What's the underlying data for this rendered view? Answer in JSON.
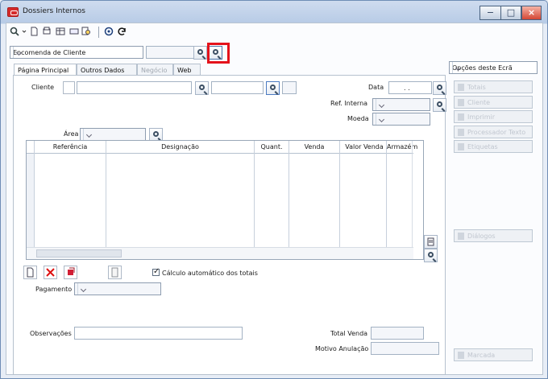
{
  "window": {
    "title": "Dossiers Internos"
  },
  "toolbar": {
    "icons": [
      "search-icon",
      "new-document-icon",
      "print-icon",
      "table-icon",
      "keyboard-icon",
      "document-search-icon",
      "settings-icon",
      "refresh-icon"
    ]
  },
  "document_type": {
    "value": "Encomenda de Cliente"
  },
  "tabs": [
    {
      "label": "Página Principal"
    },
    {
      "label": "Outros Dados"
    },
    {
      "label": "Negócio"
    },
    {
      "label": "Web"
    }
  ],
  "fields": {
    "cliente": "Cliente",
    "data": "Data",
    "data_value": ". .",
    "ref_interna": "Ref. Interna",
    "moeda": "Moeda",
    "area": "Área",
    "pagamento": "Pagamento",
    "observacoes": "Observações",
    "total_venda": "Total Venda",
    "motivo_anulacao": "Motivo Anulação"
  },
  "grid": {
    "headers": [
      "Referência",
      "Designação",
      "Quant.",
      "Venda",
      "Valor Venda",
      "Armazém"
    ]
  },
  "controls": {
    "auto_calc": "Cálculo automático dos totais",
    "auto_calc_checked": true
  },
  "right_panel": {
    "options": "Opções deste Ecrã",
    "buttons": [
      "Totais",
      "Cliente",
      "Imprimir",
      "Processador Texto",
      "Etiquetas",
      "Diálogos",
      "Marcada"
    ]
  }
}
